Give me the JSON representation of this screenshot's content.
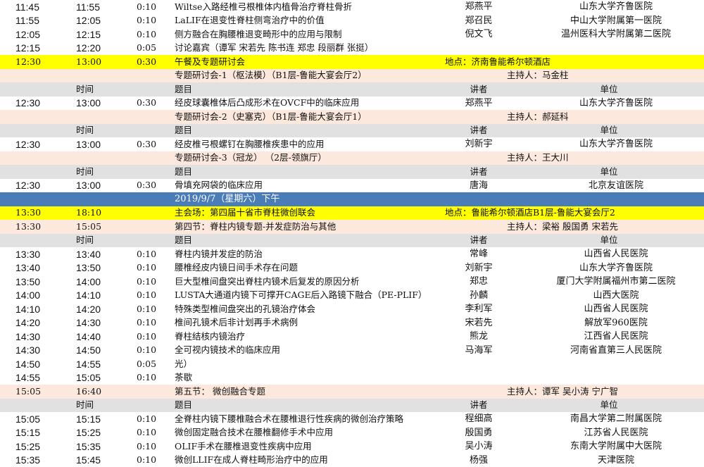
{
  "rows": [
    {
      "type": "talk",
      "start": "11:45",
      "end": "11:55",
      "dur": "0:10",
      "topic": "Wiltse入路经椎弓根椎体内植骨治疗脊柱骨折",
      "speaker": "郑燕平",
      "unit": "山东大学齐鲁医院"
    },
    {
      "type": "talk",
      "start": "11:55",
      "end": "12:05",
      "dur": "0:10",
      "topic": "LaLIF在退变性脊柱侧弯治疗中的价值",
      "speaker": "郑召民",
      "unit": "中山大学附属第一医院"
    },
    {
      "type": "talk",
      "start": "12:05",
      "end": "12:15",
      "dur": "0:10",
      "topic": "侧方融合在胸腰椎退变畸形中的应用与限制",
      "speaker": "倪文飞",
      "unit": "温州医科大学附属第二医院"
    },
    {
      "type": "talk",
      "start": "12:15",
      "end": "12:20",
      "dur": "0:05",
      "topic": "讨论嘉宾（谭军 宋若先 陈书连 郑忠 段丽群  张挺）",
      "speaker": "",
      "unit": ""
    },
    {
      "type": "session",
      "start": "12:30",
      "end": "13:00",
      "dur": "0:30",
      "topic": "午餐及专题研讨会",
      "location": "地点：济南鲁能希尔顿酒店"
    },
    {
      "type": "subsession",
      "topic": "专题研讨会-1（枢法模）（B1层-鲁能大宴会厅2）",
      "host": "主持人：马金柱"
    },
    {
      "type": "header",
      "time": "时间",
      "topic": "题目",
      "speaker": "讲者",
      "unit": "单位"
    },
    {
      "type": "talk",
      "start": "12:30",
      "end": "13:00",
      "dur": "0:30",
      "topic": " 经皮球囊椎体后凸成形术在OVCF中的临床应用",
      "speaker": "郑燕平",
      "unit": "山东大学齐鲁医院"
    },
    {
      "type": "subsession",
      "topic": "专题研讨会-2（史塞克）（B1层-鲁能大宴会厅1）",
      "host": "主持人：郝延科"
    },
    {
      "type": "header",
      "time": "时间",
      "topic": "题目",
      "speaker": "讲者",
      "unit": "单位"
    },
    {
      "type": "talk",
      "start": "12:30",
      "end": "13:00",
      "dur": "0:30",
      "topic": "经皮椎弓根螺钉在胸腰椎疾患中的应用",
      "speaker": "刘新宇",
      "unit": "山东大学齐鲁医院"
    },
    {
      "type": "subsession",
      "topic": "专题研讨会-3（冠龙）  （2层-领旗厅）",
      "host": "主持人：王大川"
    },
    {
      "type": "header",
      "time": "时间",
      "topic": "题目",
      "speaker": "讲者",
      "unit": "单位"
    },
    {
      "type": "talk",
      "start": "12:30",
      "end": "13:00",
      "dur": "0:30",
      "topic": "骨填充网袋的临床应用",
      "speaker": "唐海",
      "unit": "北京友谊医院"
    },
    {
      "type": "date",
      "text": "2019/9/7（星期六）下午"
    },
    {
      "type": "session",
      "start": "13:30",
      "end": "18:10",
      "dur": "",
      "topic": "主会场：第四届十省市脊柱微创联会",
      "location": "地点：鲁能希尔顿酒店B1层-鲁能大宴会厅2"
    },
    {
      "type": "subsession",
      "start": "13:30",
      "end": "15:05",
      "topic": "第四节：脊柱内镜专题-并发症防治与其他",
      "host": "主持人：梁裕 殷国勇 宋若先"
    },
    {
      "type": "header",
      "time": "时间",
      "topic": "题目",
      "speaker": "讲者",
      "unit": "单位"
    },
    {
      "type": "talk",
      "start": "13:30",
      "end": "13:40",
      "dur": "0:10",
      "topic": "脊柱内镜并发症的防治",
      "speaker": "常峰",
      "unit": "山西省人民医院"
    },
    {
      "type": "talk",
      "start": "13:40",
      "end": "13:50",
      "dur": "0:10",
      "topic": "腰椎经皮内镜日间手术存在问题",
      "speaker": "刘新宇",
      "unit": "山东大学齐鲁医院"
    },
    {
      "type": "talk",
      "start": "13:50",
      "end": "14:00",
      "dur": "0:10",
      "topic": "巨大型椎间盘突出脊柱内镜术后复发的原因分析",
      "speaker": "郑忠",
      "unit": "厦门大学附属福州市第二医院"
    },
    {
      "type": "talk",
      "start": "14:00",
      "end": "14:10",
      "dur": "0:10",
      "topic": "LUSTA大通道内镜下可撑开CAGE后入路镜下融合（PE-PLIF）",
      "speaker": "孙麟",
      "unit": "山西大医院"
    },
    {
      "type": "talk",
      "start": "14:10",
      "end": "14:20",
      "dur": "0:10",
      "topic": "特殊类型椎间盘突出的孔镜治疗体会",
      "speaker": "李利军",
      "unit": "山西省人民医院"
    },
    {
      "type": "talk",
      "start": "14:20",
      "end": "14:30",
      "dur": "0:10",
      "topic": "椎间孔镜术后非计划再手术病例",
      "speaker": "宋若先",
      "unit": "解放军960医院"
    },
    {
      "type": "talk",
      "start": "14:30",
      "end": "14:40",
      "dur": "0:10",
      "topic": "脊柱结核内镜治疗",
      "speaker": "熊龙",
      "unit": "江西省人民医院"
    },
    {
      "type": "talk",
      "start": "14:30",
      "end": "14:50",
      "dur": "0:10",
      "topic": "全可视内镜技术的临床应用",
      "speaker": "马海军",
      "unit": "河南省直第三人民医院"
    },
    {
      "type": "talk",
      "start": "14:50",
      "end": "14:55",
      "dur": "0:05",
      "topic": "光）",
      "speaker": "",
      "unit": ""
    },
    {
      "type": "talk",
      "start": "14:55",
      "end": "15:05",
      "dur": "0:10",
      "topic": "茶歇",
      "speaker": "",
      "unit": ""
    },
    {
      "type": "subsession",
      "start": "15:05",
      "end": "16:40",
      "topic": "第五节： 微创融合专题",
      "host": "主持人：谭军 吴小涛 宁广智"
    },
    {
      "type": "header",
      "time": "时间",
      "topic": "题目",
      "speaker": "讲者",
      "unit": "单位"
    },
    {
      "type": "talk",
      "start": "15:05",
      "end": "15:15",
      "dur": "0:10",
      "topic": "全脊柱内镜下腰椎融合术在腰椎退行性疾病的微创治疗策略",
      "speaker": "程细高",
      "unit": "南昌大学第二附属医院"
    },
    {
      "type": "talk",
      "start": "15:15",
      "end": "15:25",
      "dur": "0:10",
      "topic": "微创固定融合技术在腰椎翻修手术中应用",
      "speaker": "殷国勇",
      "unit": "江苏省人民医院"
    },
    {
      "type": "talk",
      "start": "15:25",
      "end": "15:35",
      "dur": "0:10",
      "topic": "OLIF手术在腰椎退变性疾病中应用",
      "speaker": "吴小涛",
      "unit": "东南大学附属中大医院"
    },
    {
      "type": "talk",
      "start": "15:35",
      "end": "15:45",
      "dur": "0:10",
      "topic": "微创LLIF在成人脊柱畸形治疗中的应用",
      "speaker": "杨强",
      "unit": "天津医院"
    }
  ]
}
